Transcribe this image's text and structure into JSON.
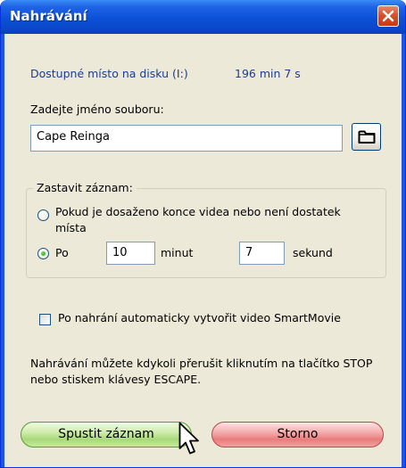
{
  "window": {
    "title": "Nahrávání",
    "close_icon": "close-icon"
  },
  "disk": {
    "label": "Dostupné místo na disku (I:)",
    "value": "196 min 7 s"
  },
  "filename": {
    "label": "Zadejte jméno souboru:",
    "value": "Cape Reinga",
    "browse_icon": "folder-icon"
  },
  "stop": {
    "group_label": "Zastavit záznam:",
    "option_end_label": "Pokud je dosaženo konce videa nebo není dostatek místa",
    "option_end_selected": false,
    "option_time_label": "Po",
    "option_time_selected": true,
    "minutes_value": "10",
    "minutes_label": "minut",
    "seconds_value": "7",
    "seconds_label": "sekund"
  },
  "smartmovie": {
    "label": "Po nahrání automaticky vytvořit video SmartMovie",
    "checked": false
  },
  "info": {
    "text": "Nahrávání můžete kdykoli přerušit kliknutím na tlačítko STOP nebo stiskem klávesy ESCAPE."
  },
  "buttons": {
    "start_label": "Spustit záznam",
    "cancel_label": "Storno"
  },
  "colors": {
    "title_bar": "#0a50d8",
    "dialog_bg": "#ece9d8",
    "disk_text": "#1f3c8c",
    "start_button": "#a8d978",
    "cancel_button": "#e97c7c"
  }
}
